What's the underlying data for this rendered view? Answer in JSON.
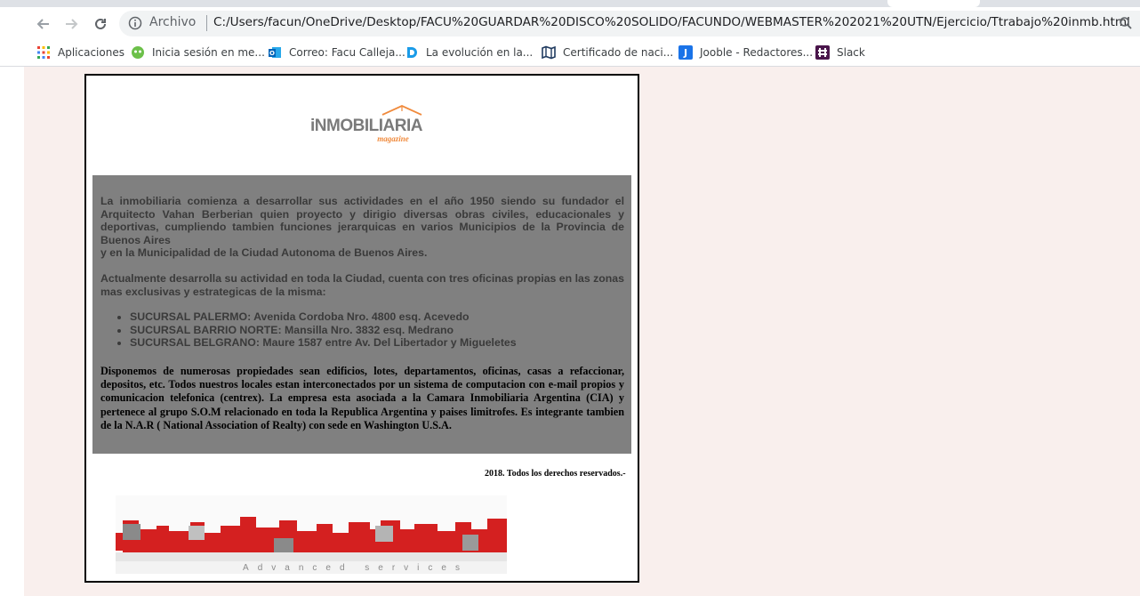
{
  "browser": {
    "address": {
      "scheme_label": "Archivo",
      "url": "C:/Users/facun/OneDrive/Desktop/FACU%20GUARDAR%20DISCO%20SOLIDO/FACUNDO/WEBMASTER%202021%20UTN/Ejercicio/Ttrabajo%20inmb.html"
    },
    "bookmarks": [
      {
        "label": "Aplicaciones",
        "icon": "apps-grid-icon"
      },
      {
        "label": "Inicia sesión en me...",
        "icon": "green-circle-icon"
      },
      {
        "label": "Correo: Facu Calleja...",
        "icon": "outlook-icon"
      },
      {
        "label": "La evolución en la...",
        "icon": "blue-d-icon"
      },
      {
        "label": "Certificado de naci...",
        "icon": "map-icon"
      },
      {
        "label": "Jooble - Redactores...",
        "icon": "jooble-icon"
      },
      {
        "label": "Slack",
        "icon": "slack-icon"
      }
    ]
  },
  "doc": {
    "logo": {
      "main": "iNMOBILIARIA",
      "sub": "magazine"
    },
    "paragraph1": "La inmobiliaria comienza a desarrollar sus actividades en el año 1950 siendo su fundador el Arquitecto Vahan Berberian quien proyecto y dirigio diversas obras civiles, educacionales y deportivas, cumpliendo tambien funciones jerarquicas en varios Municipios de la Provincia de Buenos Aires",
    "paragraph1b": "y en la Municipalidad de la Ciudad Autonoma de Buenos Aires.",
    "paragraph2": "Actualmente desarrolla su actividad en toda la Ciudad, cuenta con tres oficinas propias en las zonas mas exclusivas y estrategicas de la misma:",
    "branches": [
      "SUCURSAL PALERMO: Avenida Cordoba Nro. 4800 esq. Acevedo",
      "SUCURSAL BARRIO NORTE: Mansilla Nro. 3832 esq. Medrano",
      "SUCURSAL BELGRANO: Maure 1587 entre Av. Del Libertador y Migueletes"
    ],
    "paragraph3": "Disponemos de numerosas propiedades sean edificios, lotes, departamentos, oficinas, casas a refaccionar, depositos, etc. Todos nuestros locales estan interconectados por un sistema de computacion con e-mail propios y comunicacion telefonica (centrex). La empresa esta asociada a la Camara Inmobiliaria Argentina (CIA) y pertenece al grupo S.O.M relacionado en toda la Republica Argentina y paises limitrofes. Es integrante tambien de la N.A.R ( National Association of Realty) con sede en Washington U.S.A.",
    "footer": "2018. Todos los derechos reservados.-",
    "banner_caption": "Advanced services"
  },
  "colors": {
    "page_bg": "#f9efed",
    "content_box": "#808080",
    "logo_orange": "#f08a3c",
    "logo_gray": "#7a7a7a",
    "banner_red": "#d42020"
  }
}
